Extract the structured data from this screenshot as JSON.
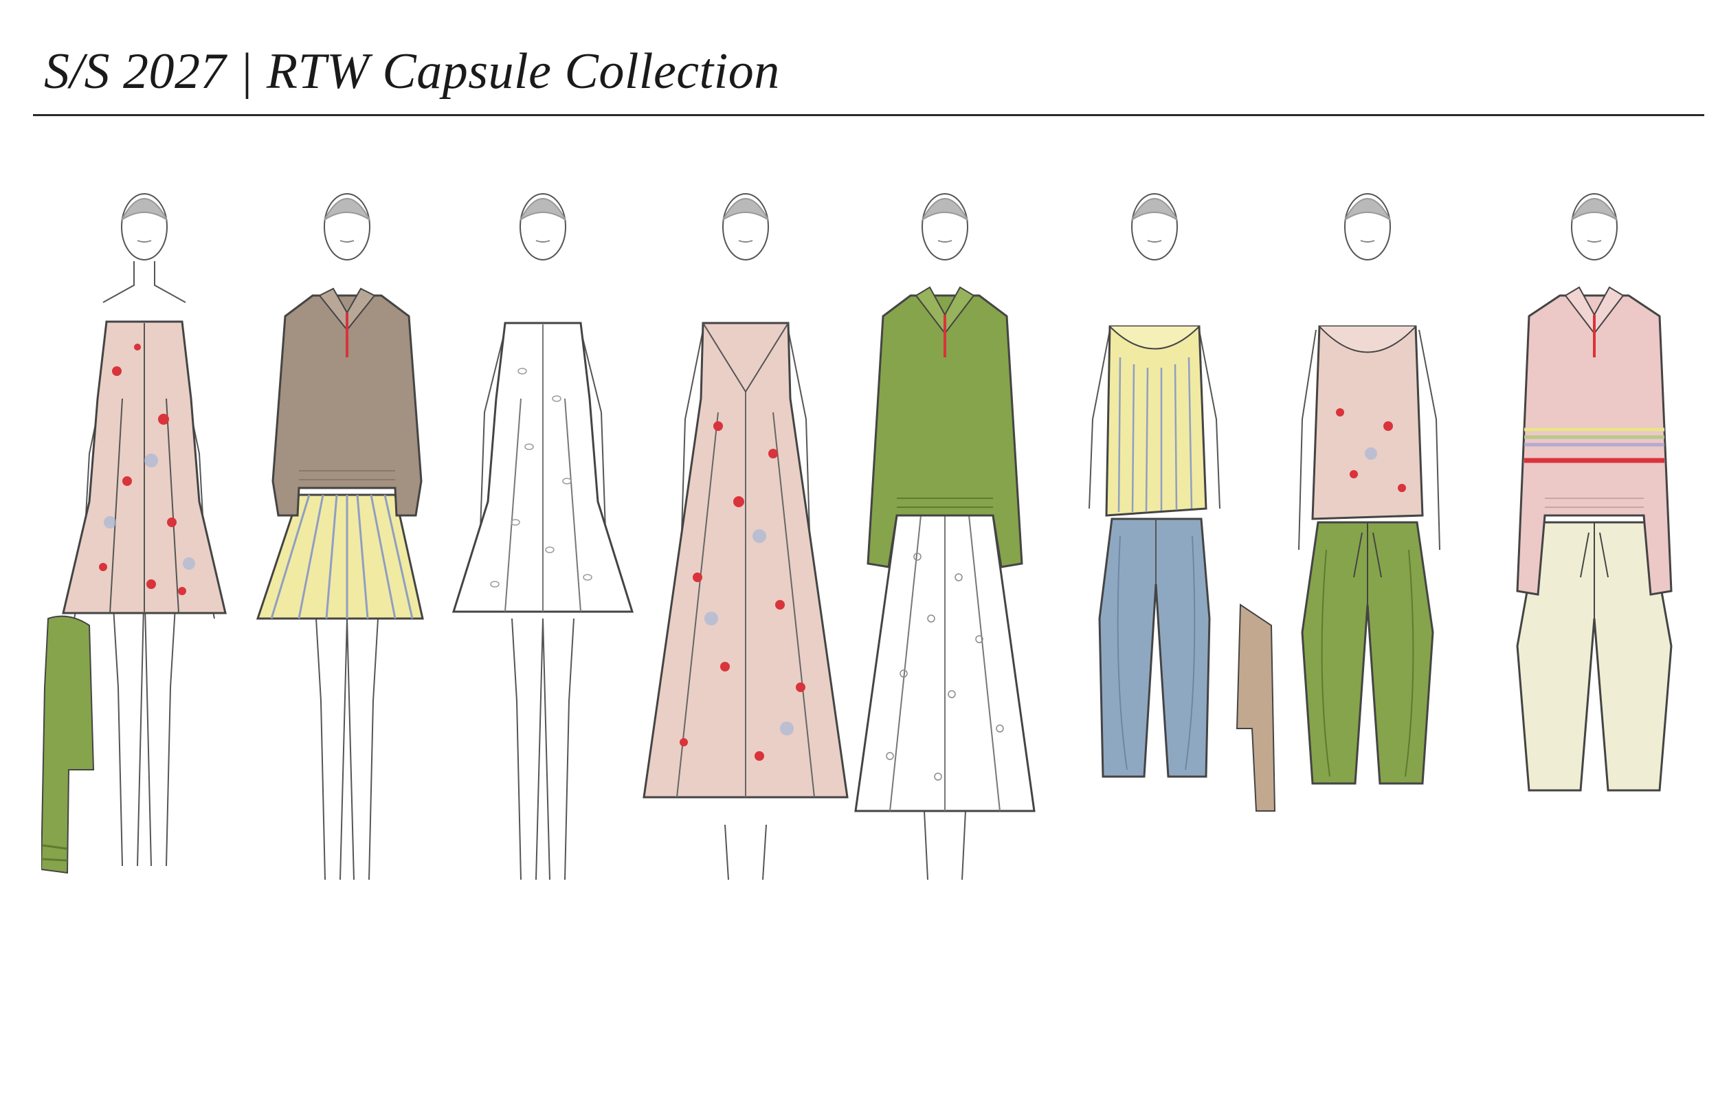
{
  "header": {
    "title": "S/S 2027 | RTW Capsule Collection"
  },
  "colors": {
    "floral": "#e9cfc6",
    "floral_accent": "#d9333b",
    "moss": "#86a44b",
    "taupe": "#a39181",
    "butter": "#f1eaa3",
    "stripe": "#8f9fc1",
    "eyelet": "#ffffff",
    "denim": "#8fa8c2",
    "camel": "#c2a88f",
    "blush": "#ecc8c6",
    "cream": "#efeed4",
    "skin": "#ffffff",
    "line": "#555555",
    "hair": "#b9b9b9"
  },
  "looks": [
    {
      "id": 1,
      "pieces": [
        "floral-tank-dress",
        "moss-sweater-carried"
      ]
    },
    {
      "id": 2,
      "pieces": [
        "taupe-polo-sweater",
        "striped-mini-skirt"
      ]
    },
    {
      "id": 3,
      "pieces": [
        "eyelet-tank-dress"
      ]
    },
    {
      "id": 4,
      "pieces": [
        "floral-slip-midi-dress"
      ]
    },
    {
      "id": 5,
      "pieces": [
        "moss-polo-sweater",
        "eyelet-midi-skirt"
      ]
    },
    {
      "id": 6,
      "pieces": [
        "striped-cowl-top",
        "denim-barrel-jeans",
        "camel-jacket-carried"
      ]
    },
    {
      "id": 7,
      "pieces": [
        "floral-cowl-top",
        "moss-drawstring-trousers"
      ]
    },
    {
      "id": 8,
      "pieces": [
        "blush-striped-polo-sweater",
        "cream-barrel-trousers"
      ]
    }
  ]
}
